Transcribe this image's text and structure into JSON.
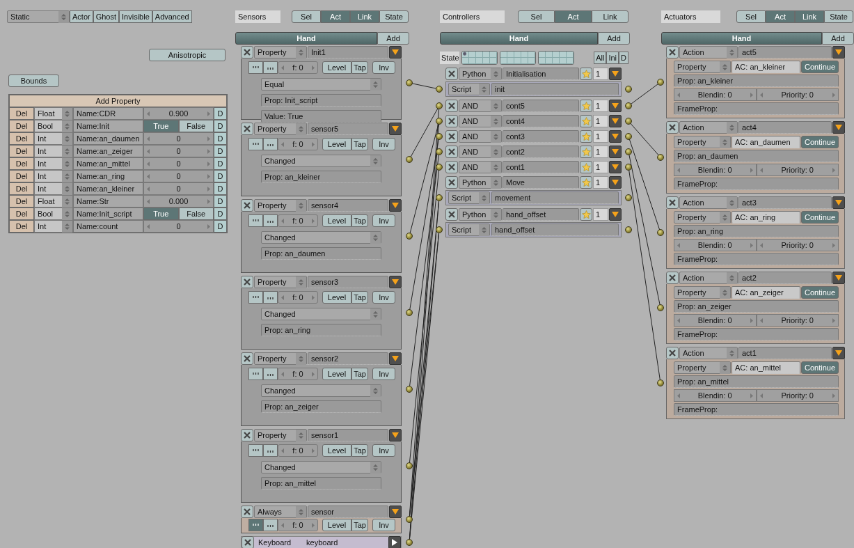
{
  "object_settings": {
    "bounds_type": "Static",
    "toggles": [
      "Actor",
      "Ghost",
      "Invisible",
      "Advanced"
    ],
    "anisotropic": "Anisotropic",
    "bounds": "Bounds"
  },
  "properties": {
    "add_label": "Add Property",
    "rows": [
      {
        "kind": "number",
        "delete": "Del",
        "type": "Float",
        "name": "Name:CDR",
        "value": "0.900",
        "debug": "D"
      },
      {
        "kind": "bool",
        "delete": "Del",
        "type": "Bool",
        "name": "Name:Init",
        "true_label": "True",
        "false_label": "False",
        "value": true,
        "debug": "D"
      },
      {
        "kind": "number",
        "delete": "Del",
        "type": "Int",
        "name": "Name:an_daumen",
        "value": "0",
        "debug": "D"
      },
      {
        "kind": "number",
        "delete": "Del",
        "type": "Int",
        "name": "Name:an_zeiger",
        "value": "0",
        "debug": "D"
      },
      {
        "kind": "number",
        "delete": "Del",
        "type": "Int",
        "name": "Name:an_mittel",
        "value": "0",
        "debug": "D"
      },
      {
        "kind": "number",
        "delete": "Del",
        "type": "Int",
        "name": "Name:an_ring",
        "value": "0",
        "debug": "D"
      },
      {
        "kind": "number",
        "delete": "Del",
        "type": "Int",
        "name": "Name:an_kleiner",
        "value": "0",
        "debug": "D"
      },
      {
        "kind": "number",
        "delete": "Del",
        "type": "Float",
        "name": "Name:Str",
        "value": "0.000",
        "debug": "D"
      },
      {
        "kind": "bool",
        "delete": "Del",
        "type": "Bool",
        "name": "Name:Init_script",
        "true_label": "True",
        "false_label": "False",
        "value": true,
        "debug": "D"
      },
      {
        "kind": "number",
        "delete": "Del",
        "type": "Int",
        "name": "Name:count",
        "value": "0",
        "debug": "D"
      }
    ]
  },
  "sensors": {
    "title": "Sensors",
    "filters": [
      {
        "label": "Sel",
        "selected": false
      },
      {
        "label": "Act",
        "selected": true
      },
      {
        "label": "Link",
        "selected": true
      },
      {
        "label": "State",
        "selected": false
      }
    ],
    "object": "Hand",
    "add": "Add",
    "items": [
      {
        "kind": "property",
        "type": "Property",
        "name": "Init1",
        "expanded": true,
        "pulse_true": false,
        "frequency": "f: 0",
        "level_button": "Level",
        "tap": "Tap",
        "invert": "Inv",
        "mode": "Equal",
        "prop": "Prop: Init_script",
        "value": "Value: True"
      },
      {
        "kind": "property",
        "type": "Property",
        "name": "sensor5",
        "expanded": true,
        "pulse_true": false,
        "frequency": "f: 0",
        "level_button": "Level",
        "tap": "Tap",
        "invert": "Inv",
        "mode": "Changed",
        "prop": "Prop: an_kleiner"
      },
      {
        "kind": "property",
        "type": "Property",
        "name": "sensor4",
        "expanded": true,
        "pulse_true": false,
        "frequency": "f: 0",
        "level_button": "Level",
        "tap": "Tap",
        "invert": "Inv",
        "mode": "Changed",
        "prop": "Prop: an_daumen"
      },
      {
        "kind": "property",
        "type": "Property",
        "name": "sensor3",
        "expanded": true,
        "pulse_true": false,
        "frequency": "f: 0",
        "level_button": "Level",
        "tap": "Tap",
        "invert": "Inv",
        "mode": "Changed",
        "prop": "Prop: an_ring"
      },
      {
        "kind": "property",
        "type": "Property",
        "name": "sensor2",
        "expanded": true,
        "pulse_true": false,
        "frequency": "f: 0",
        "level_button": "Level",
        "tap": "Tap",
        "invert": "Inv",
        "mode": "Changed",
        "prop": "Prop: an_zeiger"
      },
      {
        "kind": "property",
        "type": "Property",
        "name": "sensor1",
        "expanded": true,
        "pulse_true": false,
        "frequency": "f: 0",
        "level_button": "Level",
        "tap": "Tap",
        "invert": "Inv",
        "mode": "Changed",
        "prop": "Prop: an_mittel"
      },
      {
        "kind": "always",
        "type": "Always",
        "name": "sensor",
        "expanded": true,
        "pulse_true": true,
        "frequency": "f: 0",
        "level_button": "Level",
        "tap": "Tap",
        "invert": "Inv"
      },
      {
        "kind": "keyboard",
        "type": "Keyboard",
        "name": "keyboard",
        "expanded": false
      }
    ]
  },
  "controllers": {
    "title": "Controllers",
    "filters": [
      {
        "label": "Sel",
        "selected": false
      },
      {
        "label": "Act",
        "selected": true
      },
      {
        "label": "Link",
        "selected": false
      }
    ],
    "object": "Hand",
    "add": "Add",
    "state_label": "State",
    "state_cells": [
      {
        "on": true
      },
      {
        "on": false
      },
      {
        "on": false
      },
      {
        "on": false
      },
      {
        "on": false
      },
      {
        "on": false
      },
      {
        "on": false
      },
      {
        "on": false
      },
      {
        "on": false
      },
      {
        "on": false
      },
      {
        "on": false
      },
      {
        "on": false
      },
      {
        "on": false
      },
      {
        "on": false
      },
      {
        "on": false
      },
      {
        "on": false
      },
      {
        "on": false
      },
      {
        "on": false
      },
      {
        "on": false
      },
      {
        "on": false
      },
      {
        "on": false
      },
      {
        "on": false
      },
      {
        "on": false
      },
      {
        "on": false
      },
      {
        "on": false
      },
      {
        "on": false
      },
      {
        "on": false
      },
      {
        "on": false
      },
      {
        "on": false
      },
      {
        "on": false
      }
    ],
    "state_buttons": [
      "All",
      "Ini",
      "D"
    ],
    "items": [
      {
        "kind": "python",
        "type": "Python",
        "name": "Initialisation",
        "state": "1",
        "script_label": "Script",
        "script": "init"
      },
      {
        "kind": "and",
        "type": "AND",
        "name": "cont5",
        "state": "1"
      },
      {
        "kind": "and",
        "type": "AND",
        "name": "cont4",
        "state": "1"
      },
      {
        "kind": "and",
        "type": "AND",
        "name": "cont3",
        "state": "1"
      },
      {
        "kind": "and",
        "type": "AND",
        "name": "cont2",
        "state": "1"
      },
      {
        "kind": "and",
        "type": "AND",
        "name": "cont1",
        "state": "1"
      },
      {
        "kind": "python",
        "type": "Python",
        "name": "Move",
        "state": "1",
        "script_label": "Script",
        "script": "movement"
      },
      {
        "kind": "python",
        "type": "Python",
        "name": "hand_offset",
        "state": "1",
        "script_label": "Script",
        "script": "hand_offset"
      }
    ]
  },
  "actuators": {
    "title": "Actuators",
    "filters": [
      {
        "label": "Sel",
        "selected": false
      },
      {
        "label": "Act",
        "selected": true
      },
      {
        "label": "Link",
        "selected": true
      },
      {
        "label": "State",
        "selected": false
      }
    ],
    "object": "Hand",
    "add": "Add",
    "items": [
      {
        "type": "Action",
        "name": "act5",
        "mode": "Property",
        "action": "AC: an_kleiner",
        "continue": "Continue",
        "continue_on": true,
        "prop": "Prop: an_kleiner",
        "blendin": "Blendin: 0",
        "priority": "Priority: 0",
        "frame_prop": "FrameProp:"
      },
      {
        "type": "Action",
        "name": "act4",
        "mode": "Property",
        "action": "AC: an_daumen",
        "continue": "Continue",
        "continue_on": true,
        "prop": "Prop: an_daumen",
        "blendin": "Blendin: 0",
        "priority": "Priority: 0",
        "frame_prop": "FrameProp:"
      },
      {
        "type": "Action",
        "name": "act3",
        "mode": "Property",
        "action": "AC: an_ring",
        "continue": "Continue",
        "continue_on": true,
        "prop": "Prop: an_ring",
        "blendin": "Blendin: 0",
        "priority": "Priority: 0",
        "frame_prop": "FrameProp:"
      },
      {
        "type": "Action",
        "name": "act2",
        "mode": "Property",
        "action": "AC: an_zeiger",
        "continue": "Continue",
        "continue_on": true,
        "prop": "Prop: an_zeiger",
        "blendin": "Blendin: 0",
        "priority": "Priority: 0",
        "frame_prop": "FrameProp:"
      },
      {
        "type": "Action",
        "name": "act1",
        "mode": "Property",
        "action": "AC: an_mittel",
        "continue": "Continue",
        "continue_on": true,
        "prop": "Prop: an_mittel",
        "blendin": "Blendin: 0",
        "priority": "Priority: 0",
        "frame_prop": "FrameProp:"
      }
    ]
  }
}
